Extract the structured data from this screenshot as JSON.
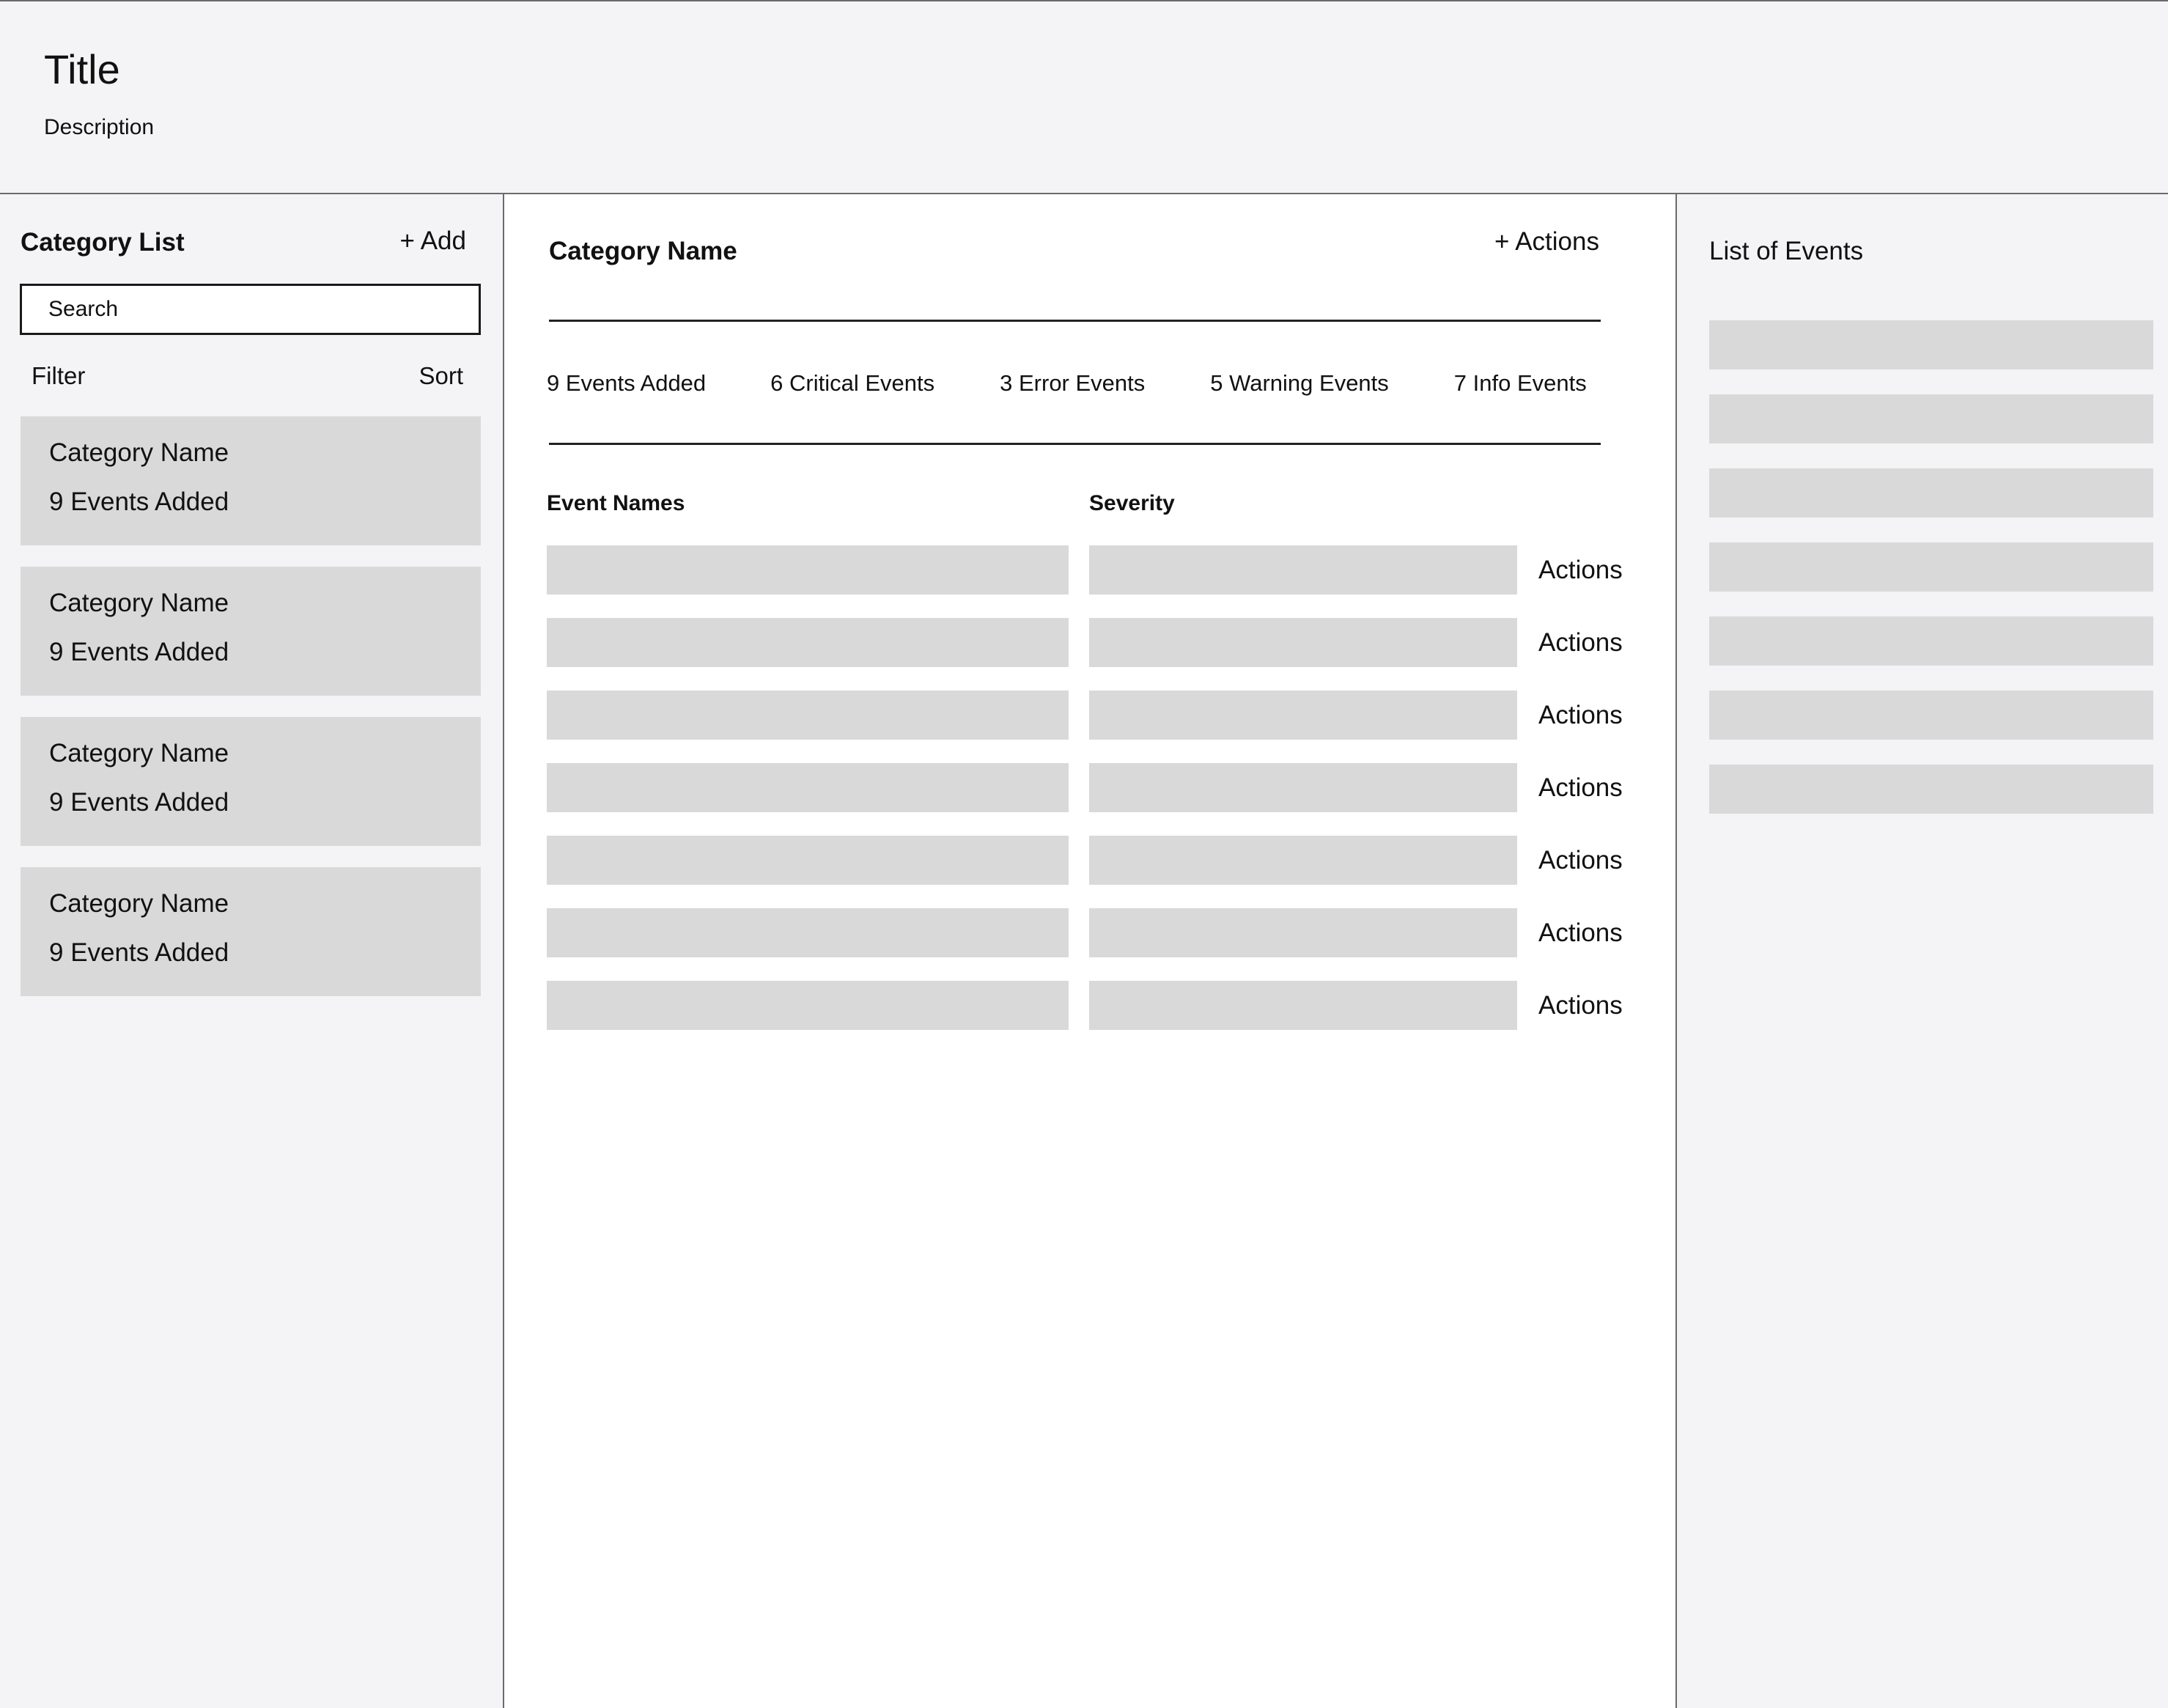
{
  "header": {
    "title": "Title",
    "description": "Description"
  },
  "sidebar": {
    "title": "Category List",
    "add_label": "+ Add",
    "search_placeholder": "Search",
    "filter_label": "Filter",
    "sort_label": "Sort",
    "categories": [
      {
        "name": "Category Name",
        "count": "9 Events Added"
      },
      {
        "name": "Category Name",
        "count": "9 Events Added"
      },
      {
        "name": "Category Name",
        "count": "9 Events Added"
      },
      {
        "name": "Category Name",
        "count": "9 Events Added"
      }
    ]
  },
  "main": {
    "category_name": "Category Name",
    "actions_label": "+ Actions",
    "stats": [
      "9 Events Added",
      "6 Critical Events",
      "3 Error Events",
      "5 Warning Events",
      "7 Info Events"
    ],
    "columns": {
      "event_names": "Event Names",
      "severity": "Severity"
    },
    "row_action_label": "Actions",
    "row_count": 7
  },
  "events_panel": {
    "title": "List of Events",
    "item_count": 7
  },
  "colors": {
    "background": "#f4f4f6",
    "placeholder_block": "#d9d9d9",
    "border": "#6b6b6b",
    "main_panel": "#ffffff"
  }
}
